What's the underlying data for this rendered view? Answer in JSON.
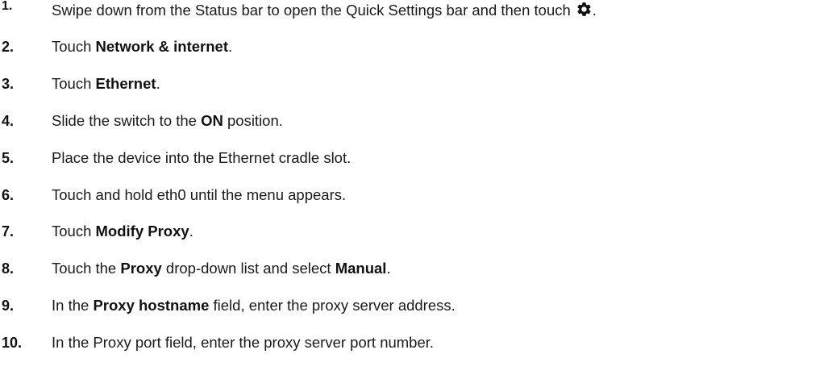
{
  "steps": [
    {
      "number": "1.",
      "parts": [
        {
          "text": "Swipe down from the Status bar to open the Quick Settings bar and then touch",
          "bold": false
        },
        {
          "icon": "gear-icon"
        },
        {
          "text": ".",
          "bold": false
        }
      ]
    },
    {
      "number": "2.",
      "parts": [
        {
          "text": "Touch ",
          "bold": false
        },
        {
          "text": "Network & internet",
          "bold": true
        },
        {
          "text": ".",
          "bold": false
        }
      ]
    },
    {
      "number": "3.",
      "parts": [
        {
          "text": "Touch ",
          "bold": false
        },
        {
          "text": "Ethernet",
          "bold": true
        },
        {
          "text": ".",
          "bold": false
        }
      ]
    },
    {
      "number": "4.",
      "parts": [
        {
          "text": "Slide the switch to the ",
          "bold": false
        },
        {
          "text": "ON",
          "bold": true
        },
        {
          "text": " position.",
          "bold": false
        }
      ]
    },
    {
      "number": "5.",
      "parts": [
        {
          "text": "Place the device into the Ethernet cradle slot.",
          "bold": false
        }
      ]
    },
    {
      "number": "6.",
      "parts": [
        {
          "text": "Touch and hold eth0 until the menu appears.",
          "bold": false
        }
      ]
    },
    {
      "number": "7.",
      "parts": [
        {
          "text": "Touch ",
          "bold": false
        },
        {
          "text": "Modify Proxy",
          "bold": true
        },
        {
          "text": ".",
          "bold": false
        }
      ]
    },
    {
      "number": "8.",
      "parts": [
        {
          "text": "Touch the ",
          "bold": false
        },
        {
          "text": "Proxy",
          "bold": true
        },
        {
          "text": " drop-down list and select ",
          "bold": false
        },
        {
          "text": "Manual",
          "bold": true
        },
        {
          "text": ".",
          "bold": false
        }
      ]
    },
    {
      "number": "9.",
      "parts": [
        {
          "text": "In the ",
          "bold": false
        },
        {
          "text": "Proxy hostname",
          "bold": true
        },
        {
          "text": " field, enter the proxy server address.",
          "bold": false
        }
      ]
    },
    {
      "number": "10.",
      "parts": [
        {
          "text": "In the Proxy port field, enter the proxy server port number.",
          "bold": false
        }
      ]
    }
  ]
}
